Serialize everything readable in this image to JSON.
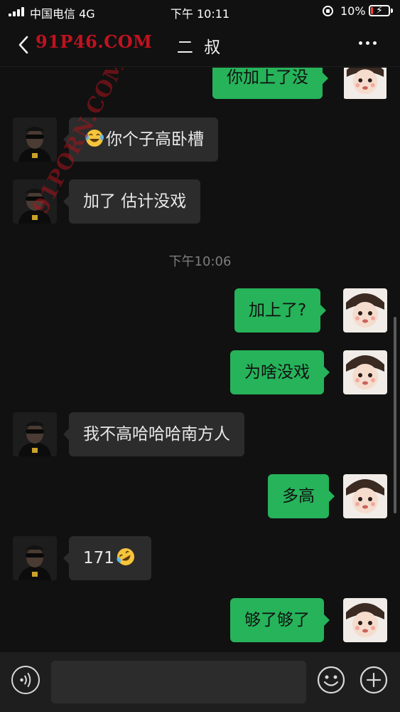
{
  "status_bar": {
    "carrier": "中国电信  4G",
    "time": "下午 10:11",
    "battery": "10%",
    "battery_level": 0.1
  },
  "nav": {
    "back_icon": "chevron-left-icon",
    "watermark": "91P46.COM",
    "title": "二 叔",
    "more_icon": "ellipsis-icon"
  },
  "chat": {
    "messages": [
      {
        "from": "me",
        "text": "你加上了没"
      },
      {
        "from": "other",
        "text": "你个子高卧槽",
        "emoji_before": "laughing-tears-emoji"
      },
      {
        "from": "other",
        "text": "加了 估计没戏"
      },
      {
        "from": "me",
        "text": "加上了?"
      },
      {
        "from": "me",
        "text": "为啥没戏"
      },
      {
        "from": "other",
        "text": "我不高哈哈哈南方人"
      },
      {
        "from": "me",
        "text": "多高"
      },
      {
        "from": "other",
        "text": "171",
        "emoji_after": "rolling-laughing-emoji"
      },
      {
        "from": "me",
        "text": "够了够了"
      }
    ],
    "timestamp": "下午10:06",
    "diagonal_watermark": "91PORN.COM"
  },
  "input_bar": {
    "voice_icon": "voice-icon",
    "emoji_icon": "smiley-icon",
    "plus_icon": "plus-icon"
  },
  "colors": {
    "background": "#111111",
    "incoming_bubble": "#2c2c2c",
    "outgoing_bubble": "#26b35a",
    "watermark": "#c1121f"
  }
}
